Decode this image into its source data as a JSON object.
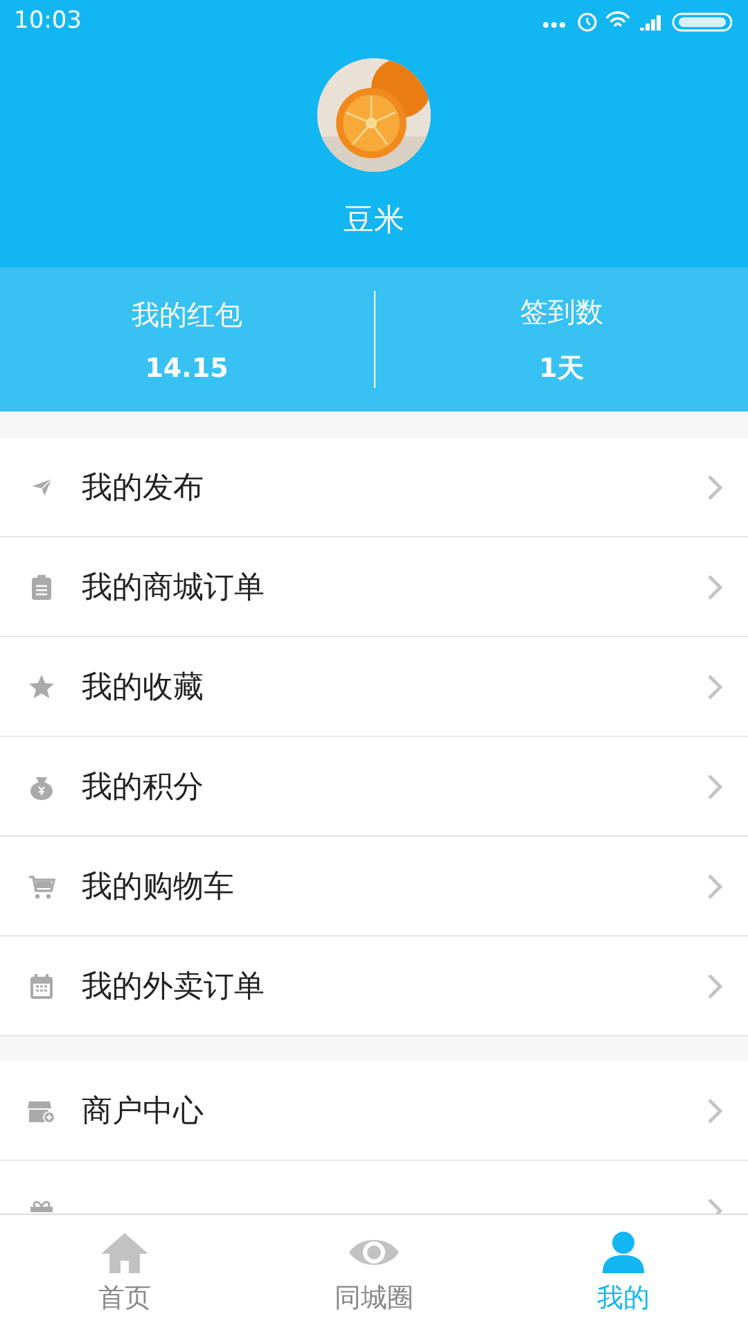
{
  "status_bar": {
    "time": "10:03"
  },
  "profile": {
    "name": "豆米"
  },
  "stats": [
    {
      "label": "我的红包",
      "value": "14.15"
    },
    {
      "label": "签到数",
      "value": "1天"
    }
  ],
  "menu_groups": [
    {
      "items": [
        {
          "label": "我的发布",
          "kind": "send"
        },
        {
          "label": "我的商城订单",
          "kind": "clipboard"
        },
        {
          "label": "我的收藏",
          "kind": "star"
        },
        {
          "label": "我的积分",
          "kind": "moneybag"
        },
        {
          "label": "我的购物车",
          "kind": "cart"
        },
        {
          "label": "我的外卖订单",
          "kind": "calendar"
        }
      ]
    },
    {
      "items": [
        {
          "label": "商户中心",
          "kind": "store"
        },
        {
          "kind": "gift"
        }
      ]
    }
  ],
  "tab_bar": [
    {
      "label": "首页",
      "kind": "home",
      "selected": false
    },
    {
      "label": "同城圈",
      "kind": "eye",
      "selected": false
    },
    {
      "label": "我的",
      "kind": "person",
      "selected": true
    }
  ]
}
